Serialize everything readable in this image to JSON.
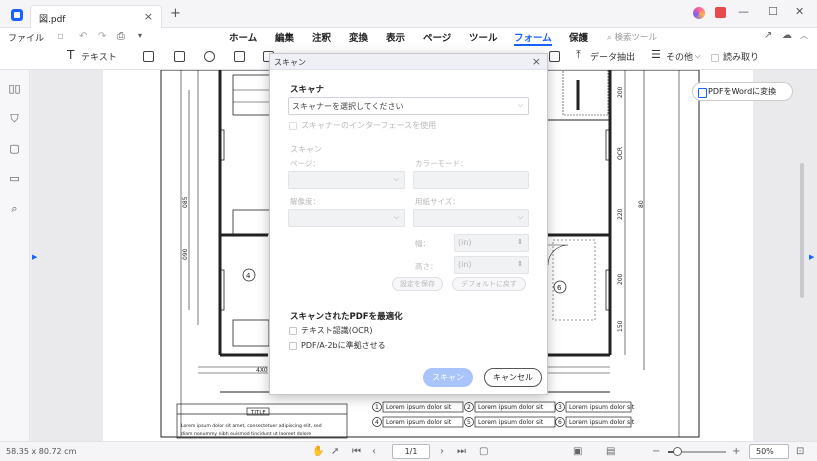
{
  "titlebar": {
    "tab_name": "図.pdf",
    "tab_close": "×",
    "add_tab": "+",
    "window_controls": [
      "—",
      "☐",
      "✕"
    ]
  },
  "menubar": {
    "file": "ファイル",
    "tabs": [
      "ホーム",
      "編集",
      "注釈",
      "変換",
      "表示",
      "ページ",
      "ツール",
      "フォーム",
      "保護"
    ],
    "active_tab": "フォーム",
    "search_tools": "検索ツール"
  },
  "toolbar": {
    "text_label": "テキスト",
    "data_extract": "データ抽出",
    "other": "その他",
    "read_only": "読み取り"
  },
  "convert_button": "PDFをWordに変換",
  "dialog": {
    "title": "スキャン",
    "close": "×",
    "scanner_heading": "スキャナ",
    "scanner_select": "スキャナーを選択してください",
    "use_interface": "スキャナーのインターフェースを使用",
    "scan_heading": "スキャン",
    "page_label": "ページ：",
    "color_mode_label": "カラーモード：",
    "resolution_label": "解像度：",
    "paper_size_label": "用紙サイズ：",
    "width_label": "幅：",
    "height_label": "高さ：",
    "width_unit": "(in)",
    "height_unit": "(in)",
    "save_settings": "設定を保存",
    "reset_default": "デフォルトに戻す",
    "optimize_heading": "スキャンされたPDFを最適化",
    "ocr_label": "テキスト認識(OCR)",
    "pdfa_label": "PDF/A-2bに準拠させる",
    "scan_button": "スキャン",
    "cancel_button": "キャンセル"
  },
  "plan": {
    "room_numbers": [
      "4",
      "6"
    ],
    "dimension_labels": [
      "200",
      "OCR",
      "220",
      "200",
      "150",
      "085",
      "090",
      "80"
    ],
    "bottom_dim": "4X0",
    "title_label": "TITLE",
    "title_text_1": "Lorem ipsum dolor sit amet, consectetuer adipiscing elit, sed",
    "title_text_2": "diam nonummy nibh euismod tincidunt ut laoreet dolore",
    "legend": [
      {
        "num": "1",
        "text": "Lorem ipsum dolor sit"
      },
      {
        "num": "2",
        "text": "Lorem ipsum dolor sit"
      },
      {
        "num": "3",
        "text": "Lorem ipsum dolor sit"
      },
      {
        "num": "4",
        "text": "Lorem ipsum dolor sit"
      },
      {
        "num": "5",
        "text": "Lorem ipsum dolor sit"
      },
      {
        "num": "6",
        "text": "Lorem ipsum dolor sit"
      }
    ]
  },
  "statusbar": {
    "dimensions": "58.35 x 80.72 cm",
    "page": "1/1",
    "zoom": "50%",
    "zoom_level": 0.15
  }
}
